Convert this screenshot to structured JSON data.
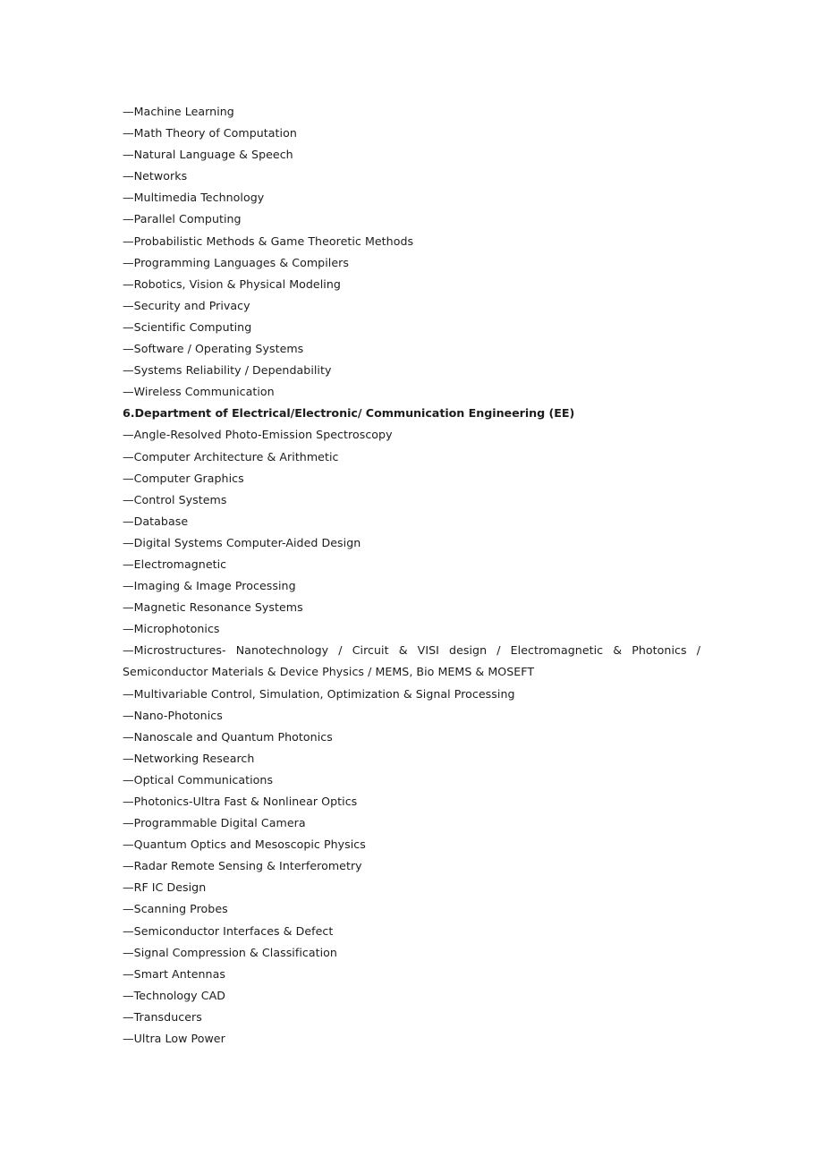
{
  "document": {
    "background_color": "#ffffff",
    "text_color": "#1c1c1c",
    "cs_department_items": [
      "—Machine Learning",
      "—Math Theory of Computation",
      "—Natural Language & Speech",
      "—Networks",
      "—Multimedia Technology",
      "—Parallel Computing",
      "—Probabilistic Methods & Game Theoretic Methods",
      "—Programming Languages & Compilers",
      "—Robotics, Vision & Physical Modeling",
      "—Security and Privacy",
      "—Scientific Computing",
      "—Software / Operating Systems",
      "—Systems Reliability / Dependability",
      "—Wireless Communication"
    ],
    "ee_section_heading": "6.Department of Electrical/Electronic/ Communication Engineering (EE)",
    "ee_items_before_paragraph": [
      "—Angle-Resolved Photo-Emission Spectroscopy",
      "—Computer Architecture & Arithmetic",
      "—Computer Graphics",
      "—Control Systems",
      "—Database",
      "—Digital Systems Computer-Aided Design",
      "—Electromagnetic",
      "—Imaging & Image Processing",
      "—Magnetic Resonance Systems",
      "—Microphotonics"
    ],
    "ee_microstructures_paragraph": "—Microstructures- Nanotechnology / Circuit & VISI design / Electromagnetic & Photonics / Semiconductor Materials & Device Physics / MEMS, Bio MEMS & MOSEFT",
    "ee_items_after_paragraph": [
      "—Multivariable Control, Simulation, Optimization & Signal Processing",
      "—Nano-Photonics",
      "—Nanoscale and Quantum Photonics",
      "—Networking Research",
      "—Optical Communications",
      "—Photonics-Ultra Fast & Nonlinear Optics",
      "—Programmable Digital Camera",
      "—Quantum Optics and Mesoscopic Physics",
      "—Radar Remote Sensing & Interferometry",
      "—RF IC Design",
      "—Scanning Probes",
      "—Semiconductor Interfaces & Defect",
      "—Signal Compression & Classification",
      "—Smart Antennas",
      "—Technology CAD",
      "—Transducers",
      "—Ultra Low Power"
    ]
  }
}
